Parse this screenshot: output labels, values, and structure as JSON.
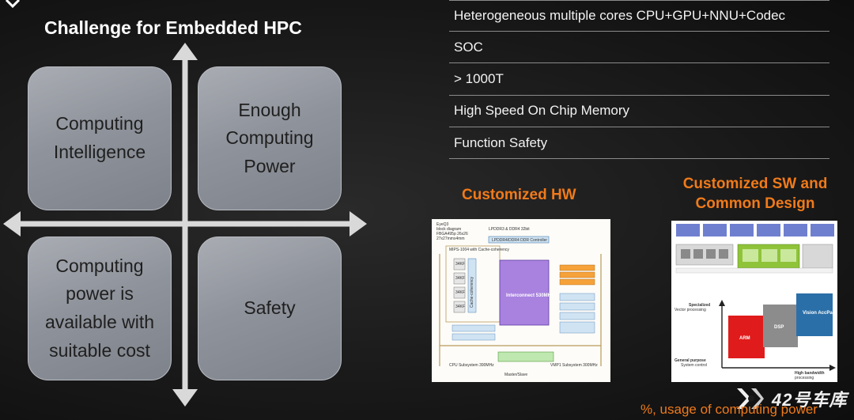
{
  "slide": {
    "title": "Challenge for Embedded HPC"
  },
  "quadrants": [
    {
      "lines": [
        "Computing",
        "Intelligence"
      ]
    },
    {
      "lines": [
        "Enough",
        "Computing",
        "Power"
      ]
    },
    {
      "lines": [
        "Computing",
        "power is",
        "available with",
        "suitable cost"
      ]
    },
    {
      "lines": [
        "Safety"
      ]
    }
  ],
  "requirements": [
    "Heterogeneous multiple cores CPU+GPU+NNU+Codec",
    "SOC",
    "> 1000T",
    "High Speed On Chip Memory",
    "Function Safety"
  ],
  "hw": {
    "title": "Customized HW",
    "diagram": {
      "heading_lines": [
        "EyeQ3",
        "block diagram",
        "FBGA495p 26x26",
        "27x27mmx4mm"
      ],
      "top_label": "LPDDR3 & DDR4 32bit",
      "controller_label": "LPDDR4/DDR4 DDR Controller",
      "mips_label": "MIPS-1004 with Cache-coherency",
      "interconnect_label": "Interconnect 530MHz",
      "left_blocks": [
        "34KF",
        "34KF",
        "34KF",
        "34KF"
      ],
      "side_label": "Cache-coherency",
      "bottom_left": "CPU Subsystem 390MHz",
      "bottom_right": "VMP1 Subsystem 300MHz",
      "bottom_center": "Master/Slave"
    }
  },
  "sw": {
    "title_lines": [
      "Customized SW and",
      "Common Design"
    ],
    "chart": {
      "y_top": [
        "Specialized",
        "Vector processing"
      ],
      "y_bottom": [
        "General purpose",
        "System control"
      ],
      "x_label": [
        "High bandwidth",
        "processing"
      ],
      "blocks": [
        {
          "label": "ARM",
          "color": "#e01b1b"
        },
        {
          "label": "DSP",
          "color": "#8c8c8c"
        },
        {
          "label": "Vision AccPac",
          "color": "#2b6fa8"
        }
      ]
    }
  },
  "watermark": "42号车库",
  "footnote": "%, usage of computing power",
  "colors": {
    "accent": "#f07a1a",
    "quadrant": "#8f939b",
    "background": "#1a1a1a"
  }
}
